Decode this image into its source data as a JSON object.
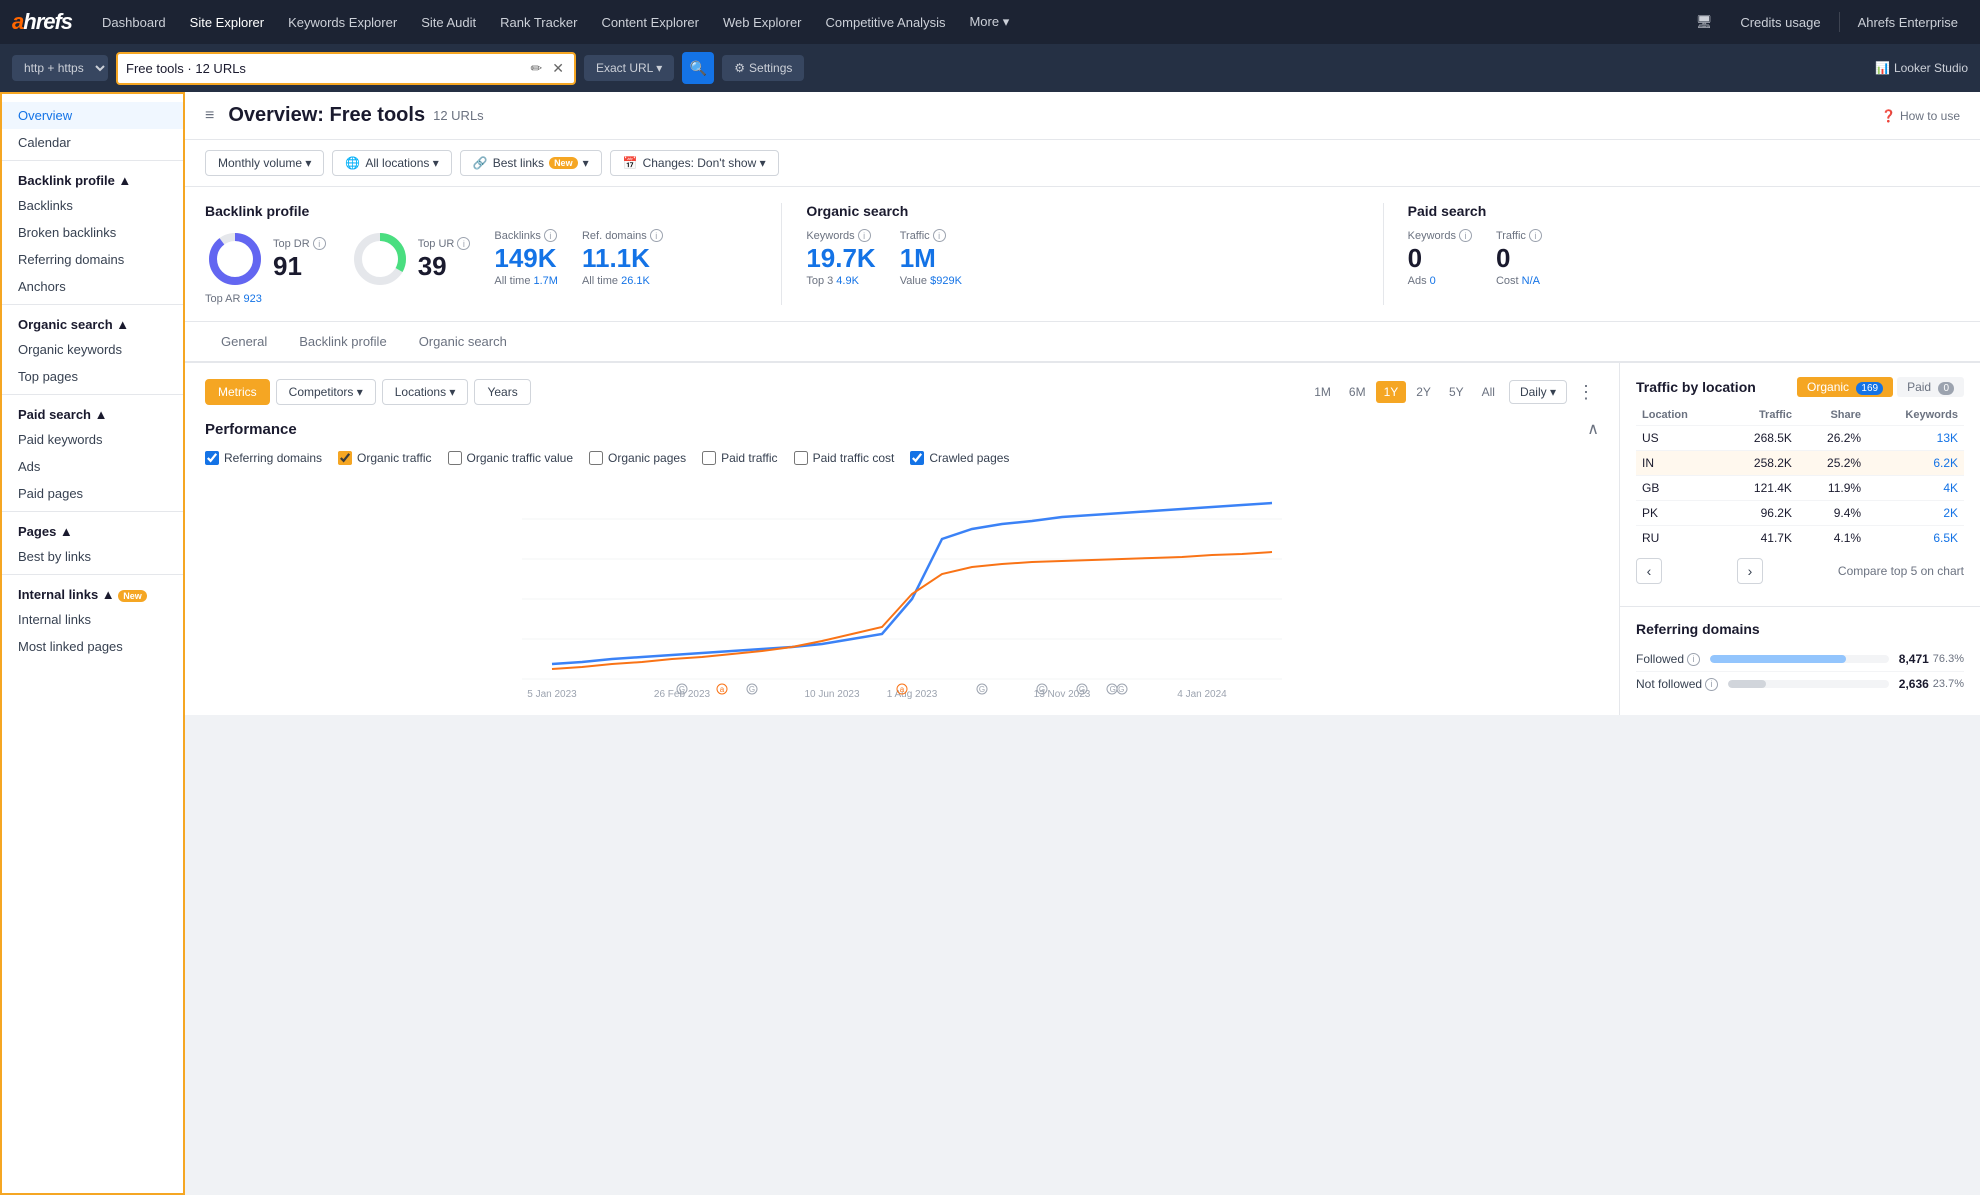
{
  "topNav": {
    "logo": "ahrefs",
    "items": [
      {
        "label": "Dashboard",
        "active": false
      },
      {
        "label": "Site Explorer",
        "active": true
      },
      {
        "label": "Keywords Explorer",
        "active": false
      },
      {
        "label": "Site Audit",
        "active": false
      },
      {
        "label": "Rank Tracker",
        "active": false
      },
      {
        "label": "Content Explorer",
        "active": false
      },
      {
        "label": "Web Explorer",
        "active": false
      },
      {
        "label": "Competitive Analysis",
        "active": false
      },
      {
        "label": "More ▾",
        "active": false
      }
    ],
    "creditsUsage": "Credits usage",
    "plan": "Ahrefs Enterprise",
    "lookerStudio": "Looker Studio",
    "monitorIcon": "🖥"
  },
  "urlBar": {
    "protocol": "http + https",
    "url": "Free tools · 12 URLs",
    "matchType": "Exact URL ▾",
    "settingsLabel": "Settings"
  },
  "pageHeader": {
    "hamburgerIcon": "≡",
    "title": "Overview: Free tools",
    "urlCount": "12 URLs",
    "howToUse": "How to use"
  },
  "filterBar": {
    "monthlyVolume": "Monthly volume ▾",
    "allLocations": "All locations ▾",
    "bestLinks": "Best links",
    "bestLinksNew": "New",
    "changes": "Changes: Don't show ▾"
  },
  "statsPanel": {
    "backlink": {
      "title": "Backlink profile",
      "topDR": {
        "label": "Top DR",
        "value": "91"
      },
      "topUR": {
        "label": "Top UR",
        "value": "39"
      },
      "topAR": {
        "label": "Top AR",
        "value": "923"
      },
      "backlinks": {
        "label": "Backlinks",
        "value": "149K"
      },
      "backlinksAllTime": "1.7M",
      "refDomains": {
        "label": "Ref. domains",
        "value": "11.1K"
      },
      "refDomainsAllTime": "26.1K"
    },
    "organicSearch": {
      "title": "Organic search",
      "keywords": {
        "label": "Keywords",
        "value": "19.7K"
      },
      "traffic": {
        "label": "Traffic",
        "value": "1M"
      },
      "keywordsTop3": "4.9K",
      "trafficValue": "$929K"
    },
    "paidSearch": {
      "title": "Paid search",
      "keywords": {
        "label": "Keywords",
        "value": "0"
      },
      "traffic": {
        "label": "Traffic",
        "value": "0"
      },
      "ads": "0",
      "cost": "N/A"
    }
  },
  "tabs": [
    {
      "label": "General",
      "active": false
    },
    {
      "label": "Backlink profile",
      "active": false
    },
    {
      "label": "Organic search",
      "active": false
    }
  ],
  "chartControls": {
    "metrics": "Metrics",
    "competitors": "Competitors ▾",
    "locations": "Locations ▾",
    "years": "Years",
    "periods": [
      "1M",
      "6M",
      "1Y",
      "2Y",
      "5Y",
      "All"
    ],
    "activePeriod": "1Y",
    "daily": "Daily ▾"
  },
  "performance": {
    "title": "Performance",
    "checkboxes": [
      {
        "label": "Referring domains",
        "checked": true,
        "color": "blue"
      },
      {
        "label": "Organic traffic",
        "checked": true,
        "color": "orange"
      },
      {
        "label": "Organic traffic value",
        "checked": false,
        "color": "gray"
      },
      {
        "label": "Organic pages",
        "checked": false,
        "color": "gray"
      },
      {
        "label": "Paid traffic",
        "checked": false,
        "color": "gray"
      },
      {
        "label": "Paid traffic cost",
        "checked": false,
        "color": "gray"
      },
      {
        "label": "Crawled pages",
        "checked": true,
        "color": "blue"
      }
    ]
  },
  "chartXLabels": [
    "5 Jan 2023",
    "26 Feb 2023",
    "10 Jun 2023",
    "1 Aug 2023",
    "13 Nov 2023",
    "4 Jan 2024"
  ],
  "trafficByLocation": {
    "title": "Traffic by location",
    "organicCount": "169",
    "paidCount": "0",
    "columns": [
      "Location",
      "Traffic",
      "Share",
      "Keywords"
    ],
    "rows": [
      {
        "location": "US",
        "traffic": "268.5K",
        "share": "26.2%",
        "keywords": "13K",
        "highlight": false
      },
      {
        "location": "IN",
        "traffic": "258.2K",
        "share": "25.2%",
        "keywords": "6.2K",
        "highlight": true
      },
      {
        "location": "GB",
        "traffic": "121.4K",
        "share": "11.9%",
        "keywords": "4K",
        "highlight": false
      },
      {
        "location": "PK",
        "traffic": "96.2K",
        "share": "9.4%",
        "keywords": "2K",
        "highlight": false
      },
      {
        "location": "RU",
        "traffic": "41.7K",
        "share": "4.1%",
        "keywords": "6.5K",
        "highlight": false
      }
    ],
    "compareLabel": "Compare top 5 on chart"
  },
  "referringDomains": {
    "title": "Referring domains",
    "rows": [
      {
        "label": "Followed",
        "value": "8,471",
        "pct": "76.3%",
        "barPct": 76.3,
        "color": "blue"
      },
      {
        "label": "Not followed",
        "value": "2,636",
        "pct": "23.7%",
        "barPct": 23.7,
        "color": "gray"
      }
    ]
  },
  "sidebar": {
    "items": [
      {
        "label": "Overview",
        "section": false,
        "active": true
      },
      {
        "label": "Calendar",
        "section": false,
        "active": false
      },
      {
        "label": "Backlink profile",
        "section": true,
        "active": false
      },
      {
        "label": "Backlinks",
        "section": false,
        "active": false
      },
      {
        "label": "Broken backlinks",
        "section": false,
        "active": false
      },
      {
        "label": "Referring domains",
        "section": false,
        "active": false
      },
      {
        "label": "Anchors",
        "section": false,
        "active": false
      },
      {
        "label": "Organic search",
        "section": true,
        "active": false
      },
      {
        "label": "Organic keywords",
        "section": false,
        "active": false
      },
      {
        "label": "Top pages",
        "section": false,
        "active": false
      },
      {
        "label": "Paid search",
        "section": true,
        "active": false
      },
      {
        "label": "Paid keywords",
        "section": false,
        "active": false
      },
      {
        "label": "Ads",
        "section": false,
        "active": false
      },
      {
        "label": "Paid pages",
        "section": false,
        "active": false
      },
      {
        "label": "Pages",
        "section": true,
        "active": false
      },
      {
        "label": "Best by links",
        "section": false,
        "active": false
      },
      {
        "label": "Internal links",
        "section": true,
        "active": false,
        "new": true
      },
      {
        "label": "Internal links",
        "section": false,
        "active": false
      },
      {
        "label": "Most linked pages",
        "section": false,
        "active": false
      }
    ]
  }
}
